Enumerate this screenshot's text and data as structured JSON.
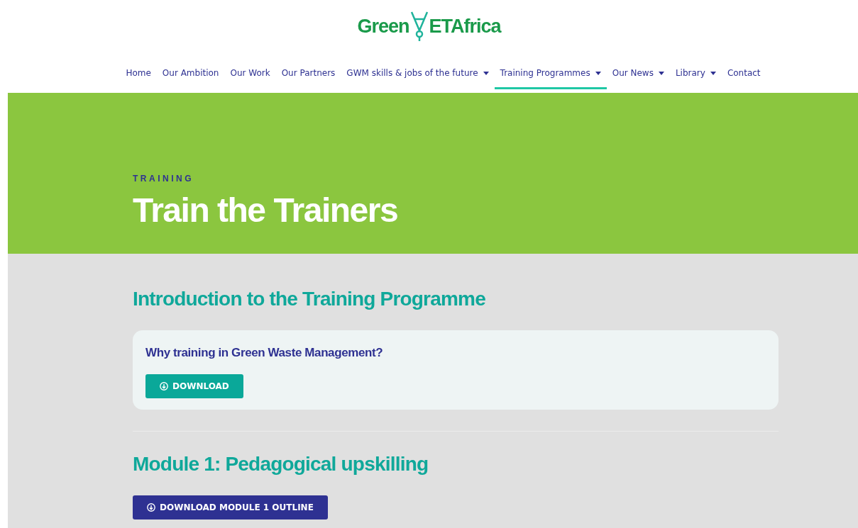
{
  "logo": {
    "part_1": "Green",
    "part_2": "ETAfrica"
  },
  "nav": [
    {
      "label": "Home",
      "dropdown": false,
      "selected": false
    },
    {
      "label": "Our Ambition",
      "dropdown": false,
      "selected": false
    },
    {
      "label": "Our Work",
      "dropdown": false,
      "selected": false
    },
    {
      "label": "Our Partners",
      "dropdown": false,
      "selected": false
    },
    {
      "label": "GWM skills & jobs of the future",
      "dropdown": true,
      "selected": false
    },
    {
      "label": "Training Programmes",
      "dropdown": true,
      "selected": true
    },
    {
      "label": "Our News",
      "dropdown": true,
      "selected": false
    },
    {
      "label": "Library",
      "dropdown": true,
      "selected": false
    },
    {
      "label": "Contact",
      "dropdown": false,
      "selected": false
    }
  ],
  "hero": {
    "eyebrow": "TRAINING",
    "title": "Train the Trainers"
  },
  "sections": [
    {
      "heading": "Introduction to the Training Programme",
      "card": {
        "title": "Why training in Green Waste Management?",
        "button": "DOWNLOAD"
      }
    },
    {
      "heading": "Module 1: Pedagogical upskilling",
      "button": "DOWNLOAD MODULE 1 OUTLINE"
    }
  ]
}
